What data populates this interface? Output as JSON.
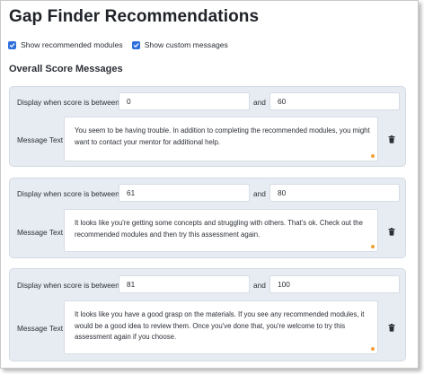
{
  "page": {
    "title": "Gap Finder Recommendations",
    "section_title": "Overall Score Messages"
  },
  "options": [
    {
      "label": "Show recommended modules",
      "checked": true
    },
    {
      "label": "Show custom messages",
      "checked": true
    }
  ],
  "labels": {
    "display_when": "Display when score is between",
    "and": "and",
    "message_text": "Message Text"
  },
  "rules": [
    {
      "min": "0",
      "max": "60",
      "message": "You seem to be having trouble. In addition to completing the recommended modules, you might want to contact your mentor for additional help."
    },
    {
      "min": "61",
      "max": "80",
      "message": "It looks like you're getting some concepts and struggling with others. That's ok. Check out the recommended modules and then try this assessment again."
    },
    {
      "min": "81",
      "max": "100",
      "message": "It looks like you have a good grasp on the materials. If you see any recommended modules, it would be a good idea to review them. Once you've done that, you're welcome to try this assessment again if you choose."
    }
  ],
  "icons": {
    "checkbox": "checkbox-checked-icon",
    "delete": "trash-icon",
    "resize": "resize-handle-icon"
  },
  "colors": {
    "accent": "#2f6fdc",
    "panel_bg": "#e7ecf2",
    "resize_handle": "#f0a038"
  }
}
